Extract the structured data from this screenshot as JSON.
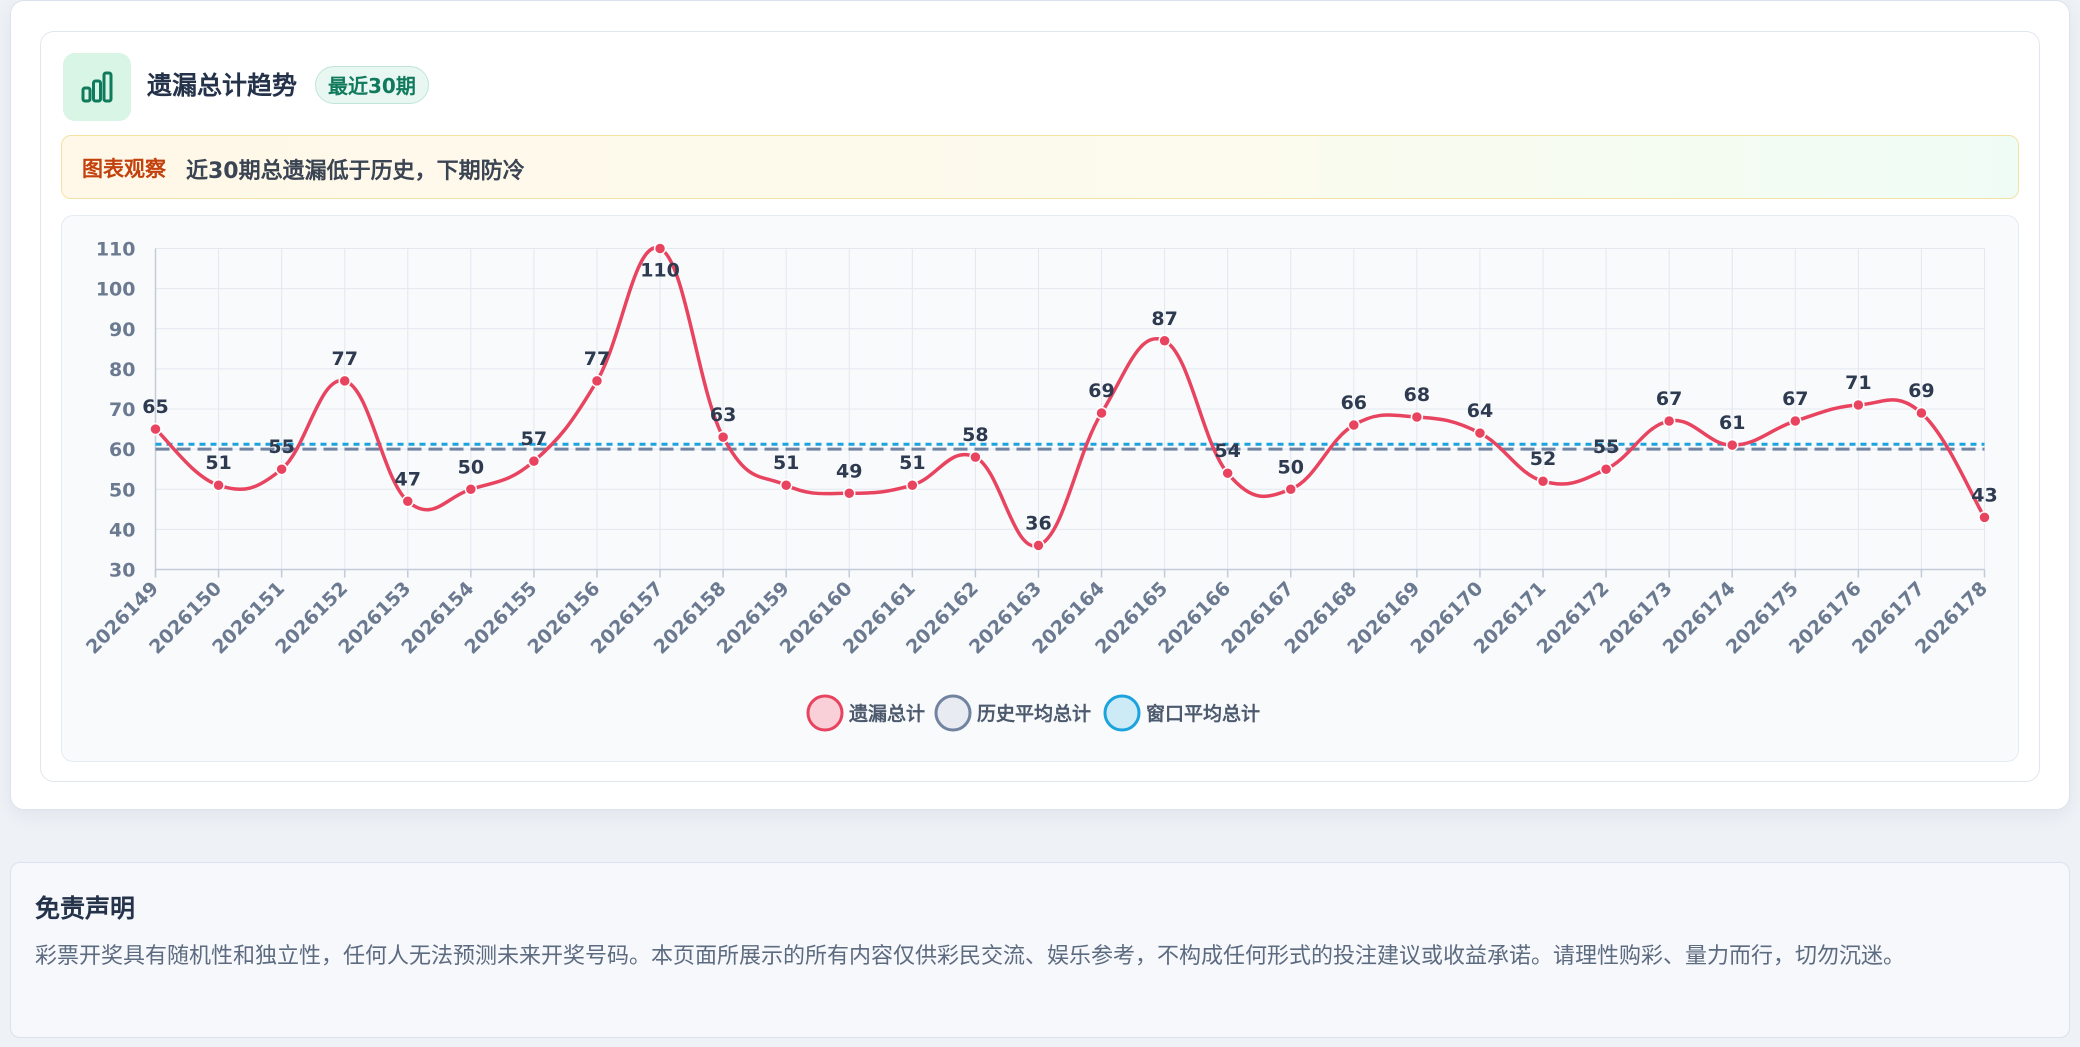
{
  "card": {
    "title": "遗漏总计趋势",
    "badge": "最近30期",
    "icon": "bar-chart-icon"
  },
  "observation": {
    "tag": "图表观察",
    "text": "近30期总遗漏低于历史，下期防冷"
  },
  "colors": {
    "accent_green": "#0f7a5c",
    "series_line": "#e8435f",
    "hist_avg": "#7183a0",
    "window_avg": "#1aa3dc",
    "warning_orange": "#c2410c"
  },
  "chart_data": {
    "type": "line",
    "x": [
      "2026149",
      "2026150",
      "2026151",
      "2026152",
      "2026153",
      "2026154",
      "2026155",
      "2026156",
      "2026157",
      "2026158",
      "2026159",
      "2026160",
      "2026161",
      "2026162",
      "2026163",
      "2026164",
      "2026165",
      "2026166",
      "2026167",
      "2026168",
      "2026169",
      "2026170",
      "2026171",
      "2026172",
      "2026173",
      "2026174",
      "2026175",
      "2026176",
      "2026177",
      "2026178"
    ],
    "series": [
      {
        "name": "遗漏总计",
        "values": [
          65,
          51,
          55,
          77,
          47,
          50,
          57,
          77,
          110,
          63,
          51,
          49,
          51,
          58,
          36,
          69,
          87,
          54,
          50,
          66,
          68,
          64,
          52,
          55,
          67,
          61,
          67,
          71,
          69,
          43
        ],
        "color": "#e8435f",
        "style": "smooth",
        "data_labels": true
      },
      {
        "name": "历史平均总计",
        "constant": 60,
        "color": "#7183a0",
        "style": "dashed"
      },
      {
        "name": "窗口平均总计",
        "constant": 61.2,
        "color": "#1aa3dc",
        "style": "dotted"
      }
    ],
    "yticks": [
      30,
      40,
      50,
      60,
      70,
      80,
      90,
      100,
      110
    ],
    "ylim": [
      30,
      110
    ],
    "grid": true,
    "legend": "bottom-center",
    "x_tick_rotation": -45
  },
  "disclaimer": {
    "title": "免责声明",
    "text": "彩票开奖具有随机性和独立性，任何人无法预测未来开奖号码。本页面所展示的所有内容仅供彩民交流、娱乐参考，不构成任何形式的投注建议或收益承诺。请理性购彩、量力而行，切勿沉迷。"
  }
}
